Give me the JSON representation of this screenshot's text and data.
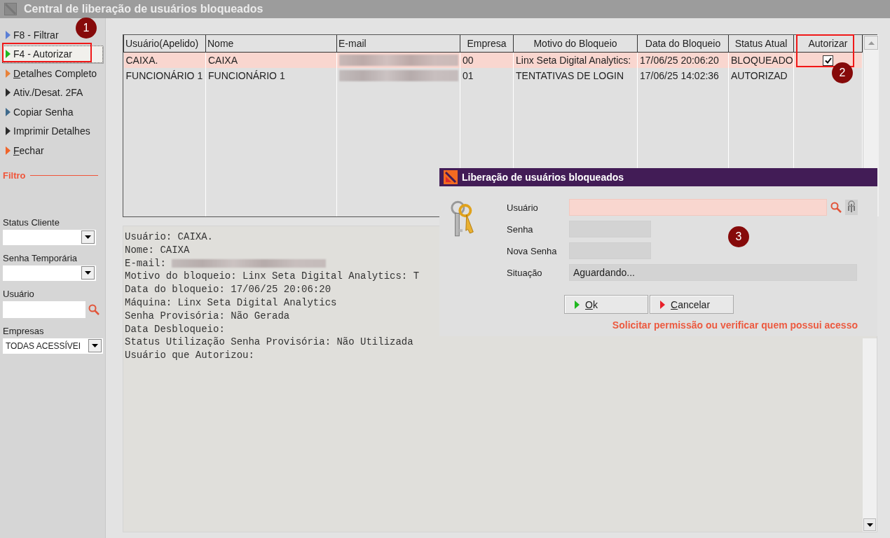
{
  "window": {
    "title": "Central de liberação de usuários bloqueados"
  },
  "sidebar": {
    "actions": [
      {
        "label": "F8 - Filtrar",
        "color": "#5b7fd6",
        "selected": false,
        "mnemonic": false
      },
      {
        "label": "F4 - Autorizar",
        "color": "#1fb81f",
        "selected": true,
        "mnemonic": false
      },
      {
        "label": "Detalhes Completo",
        "color": "#e8823a",
        "selected": false,
        "mnemonic": true
      },
      {
        "label": "Ativ./Desat. 2FA",
        "color": "#2b2b2b",
        "selected": false,
        "mnemonic": false
      },
      {
        "label": "Copiar Senha",
        "color": "#3f6a8c",
        "selected": false,
        "mnemonic": false
      },
      {
        "label": "Imprimir Detalhes",
        "color": "#2b2b2b",
        "selected": false,
        "mnemonic": false
      },
      {
        "label": "Fechar",
        "color": "#f0642a",
        "selected": false,
        "mnemonic": true
      }
    ],
    "filter_heading": "Filtro",
    "filters": [
      {
        "kind": "dropdown",
        "label": "Status Cliente"
      },
      {
        "kind": "dropdown",
        "label": "Senha Temporária"
      },
      {
        "kind": "search",
        "label": "Usuário"
      },
      {
        "kind": "dropdown",
        "label": "Empresas",
        "value": "TODAS ACESSÍVEI"
      }
    ]
  },
  "table": {
    "columns": [
      "Usuário(Apelido)",
      "Nome",
      "E-mail",
      "Empresa",
      "Motivo do Bloqueio",
      "Data do Bloqueio",
      "Status Atual",
      "Autorizar"
    ],
    "rows": [
      {
        "selected": true,
        "user": "CAIXA.",
        "name": "CAIXA",
        "company": "00",
        "reason": "Linx Seta Digital Analytics:",
        "date": "17/06/25 20:06:20",
        "status": "BLOQUEADO",
        "authorize": true
      },
      {
        "selected": false,
        "user": "FUNCIONÁRIO 1",
        "name": "FUNCIONÁRIO 1",
        "company": "01",
        "reason": "TENTATIVAS DE LOGIN",
        "date": "17/06/25 14:02:36",
        "status": "AUTORIZAD",
        "authorize": false
      }
    ]
  },
  "details": {
    "lines": [
      {
        "text": "Usuário: CAIXA.",
        "redacted": false
      },
      {
        "text": "Nome: CAIXA",
        "redacted": false
      },
      {
        "text": "E-mail:",
        "redacted": true
      },
      {
        "text": "Motivo do bloqueio: Linx Seta Digital Analytics: T",
        "redacted": false
      },
      {
        "text": "Data do bloqueio: 17/06/25 20:06:20",
        "redacted": false
      },
      {
        "text": "Máquina: Linx Seta Digital Analytics",
        "redacted": false
      },
      {
        "text": "Senha Provisória: Não Gerada",
        "redacted": false
      },
      {
        "text": "Data Desbloqueio:",
        "redacted": false
      },
      {
        "text": "Status Utilização Senha Provisória: Não Utilizada",
        "redacted": false
      },
      {
        "text": "Usuário que Autorizou:",
        "redacted": false
      }
    ]
  },
  "dialog": {
    "title": "Liberação de usuários bloqueados",
    "fields": [
      {
        "kind": "required",
        "label": "Usuário"
      },
      {
        "kind": "short",
        "label": "Senha"
      },
      {
        "kind": "short",
        "label": "Nova Senha"
      },
      {
        "kind": "status",
        "label": "Situação",
        "value": "Aguardando..."
      }
    ],
    "buttons": [
      {
        "label": "Ok",
        "color": "#1fb81f"
      },
      {
        "label": "Cancelar",
        "color": "#e8202a"
      }
    ],
    "warning": "Solicitar permissão ou verificar quem possui acesso"
  },
  "annotations": [
    "1",
    "2",
    "3"
  ]
}
